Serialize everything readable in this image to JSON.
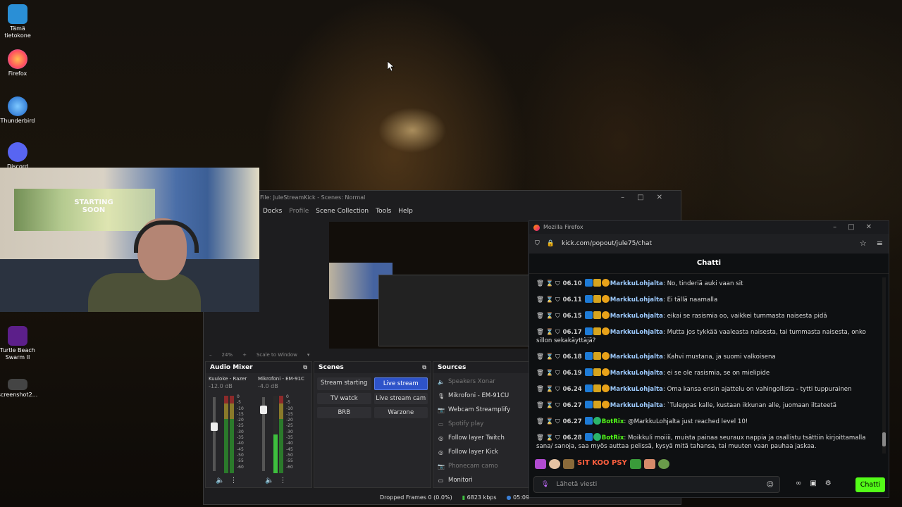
{
  "desktop": {
    "icons": [
      {
        "label": "Tämä tietokone",
        "icon": "computer-icon"
      },
      {
        "label": "Firefox",
        "icon": "firefox-icon"
      },
      {
        "label": "Thunderbird",
        "icon": "thunderbird-icon"
      },
      {
        "label": "Discord",
        "icon": "discord-icon"
      },
      {
        "label": "Turtle Beach Swarm II",
        "icon": "turtle-beach-icon"
      },
      {
        "label": "screenshot2...",
        "icon": "image-file-icon"
      }
    ]
  },
  "webcam": {
    "poster_text": "STARTING SOON"
  },
  "obs": {
    "title": "File: JuleStreamKick - Scenes: Normal",
    "menu": [
      "Docks",
      "Profile",
      "Scene Collection",
      "Tools",
      "Help"
    ],
    "zoom": "24%",
    "scale_label": "Scale to Window",
    "audio_mixer": {
      "title": "Audio Mixer",
      "channels": [
        {
          "name": "Kuuloke - Razer",
          "db": "-12.0 dB"
        },
        {
          "name": "Mikrofoni - EM-91C",
          "db": "-4.0 dB"
        }
      ],
      "scale": [
        "0",
        "-5",
        "-10",
        "-15",
        "-20",
        "-25",
        "-30",
        "-35",
        "-40",
        "-45",
        "-50",
        "-55",
        "-60"
      ]
    },
    "scenes": {
      "title": "Scenes",
      "items": [
        "Stream starting",
        "Live stream",
        "TV watck",
        "Live stream cam",
        "BRB",
        "Warzone"
      ],
      "active": "Live stream"
    },
    "sources": {
      "title": "Sources",
      "items": [
        {
          "label": "Speakers Xonar",
          "icon": "speaker-icon",
          "dim": true
        },
        {
          "label": "Mikrofoni - EM-91CU",
          "icon": "microphone-icon",
          "dim": false
        },
        {
          "label": "Webcam Streamplify",
          "icon": "camera-icon",
          "dim": false
        },
        {
          "label": "Spotify play",
          "icon": "window-icon",
          "dim": true
        },
        {
          "label": "Follow layer Twitch",
          "icon": "globe-icon",
          "dim": false
        },
        {
          "label": "Follow layer Kick",
          "icon": "globe-icon",
          "dim": false
        },
        {
          "label": "Phonecam camo",
          "icon": "camera-icon",
          "dim": true
        },
        {
          "label": "Monitori",
          "icon": "monitor-icon",
          "dim": false
        }
      ]
    },
    "status": {
      "dropped": "Dropped Frames 0 (0.0%)",
      "kbps": "6823 kbps",
      "time": "05:09"
    }
  },
  "firefox": {
    "title": "Mozilla Firefox",
    "url": "kick.com/popout/jule75/chat",
    "chat": {
      "header": "Chatti",
      "messages": [
        {
          "time": "06.10",
          "user": "MarkkuLohjalta",
          "text": "No, tinderiä auki vaan sit",
          "bot": false
        },
        {
          "time": "06.11",
          "user": "MarkkuLohjalta",
          "text": "Ei tällä naamalla",
          "bot": false
        },
        {
          "time": "06.15",
          "user": "MarkkuLohjalta",
          "text": "eikai se rasismia oo, vaikkei tummasta naisesta pidä",
          "bot": false
        },
        {
          "time": "06.17",
          "user": "MarkkuLohjalta",
          "text": "Mutta jos tykkää vaaleasta naisesta, tai tummasta naisesta, onko sillon sekakäyttäjä?",
          "bot": false
        },
        {
          "time": "06.18",
          "user": "MarkkuLohjalta",
          "text": "Kahvi mustana, ja suomi valkoisena",
          "bot": false
        },
        {
          "time": "06.19",
          "user": "MarkkuLohjalta",
          "text": "ei se ole rasismia, se on mielipide",
          "bot": false
        },
        {
          "time": "06.24",
          "user": "MarkkuLohjalta",
          "text": "Oma kansa ensin ajattelu on vahingollista - tytti tuppurainen",
          "bot": false
        },
        {
          "time": "06.27",
          "user": "MarkkuLohjalta",
          "text": "`Tuleppas kalle, kustaan ikkunan alle, juomaan iltateetä",
          "bot": false
        },
        {
          "time": "06.27",
          "user": "BotRix",
          "text": "@MarkkuLohjalta just reached level 10!",
          "bot": true
        },
        {
          "time": "06.28",
          "user": "BotRix",
          "text": "Moikkuli moiiii, muista painaa seuraux nappia ja osallistu tsättiin kirjoittamalla sana/ sanoja, saa myös auttaa pelissä, kysyä mitä tahansa, tai muuten vaan pauhaa jaskaa.",
          "bot": true
        }
      ],
      "emote_text": "SIT KOO PSY",
      "input_placeholder": "Lähetä viesti",
      "send_label": "Chatti"
    }
  }
}
